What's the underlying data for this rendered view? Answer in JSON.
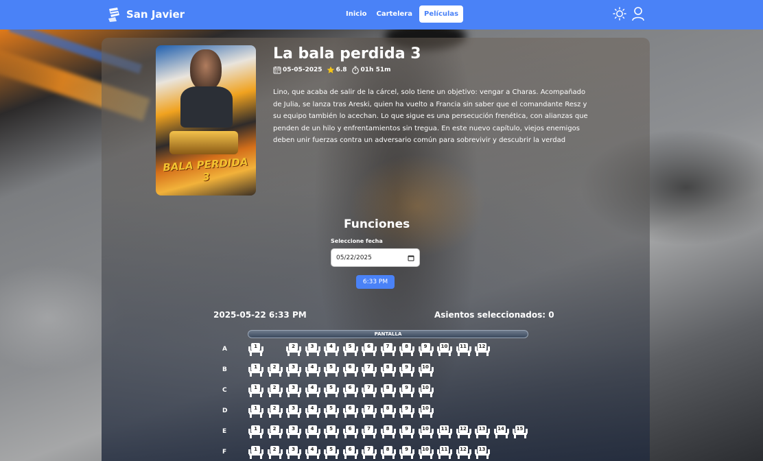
{
  "navbar": {
    "brand": "San Javier",
    "links": [
      "Inicio",
      "Cartelera",
      "Películas"
    ],
    "active_link": "Películas",
    "icons": [
      "sun-icon",
      "user-icon"
    ],
    "color": "#4a82f7"
  },
  "movie": {
    "title": "La bala perdida 3",
    "release_date": "05-05-2025",
    "rating": "6.8",
    "duration": "01h 51m",
    "poster_title": "BALA PERDIDA 3",
    "synopsis": "Lino, que acaba de salir de la cárcel, solo tiene un objetivo: vengar a Charas. Acompañado de Julia, se lanza tras Areski, quien ha vuelto a Francia sin saber que el comandante Resz y su equipo también lo acechan. Lo que sigue es una persecución frenética, con alianzas que penden de un hilo y enfrentamientos sin tregua. En este nuevo capítulo, viejos enemigos deben unir fuerzas contra un adversario común para sobrevivir y descubrir la verdad"
  },
  "funciones": {
    "title": "Funciones",
    "date_label": "Seleccione fecha",
    "date_value": "05/22/2025",
    "times": [
      "6:33 PM"
    ]
  },
  "seating": {
    "selected_datetime": "2025-05-22 6:33 PM",
    "selected_count_label": "Asientos seleccionados: 0",
    "screen_label": "PANTALLA",
    "rows": [
      {
        "label": "A",
        "seats": [
          1,
          null,
          2,
          3,
          4,
          5,
          6,
          7,
          8,
          9,
          10,
          11,
          12
        ]
      },
      {
        "label": "B",
        "seats": [
          1,
          2,
          3,
          4,
          5,
          6,
          7,
          8,
          9,
          10
        ]
      },
      {
        "label": "C",
        "seats": [
          1,
          2,
          3,
          4,
          5,
          6,
          7,
          8,
          9,
          10
        ]
      },
      {
        "label": "D",
        "seats": [
          1,
          2,
          3,
          4,
          5,
          6,
          7,
          8,
          9,
          10
        ]
      },
      {
        "label": "E",
        "seats": [
          1,
          2,
          3,
          4,
          5,
          6,
          7,
          8,
          9,
          10,
          11,
          12,
          13,
          14,
          15
        ]
      },
      {
        "label": "F",
        "seats": [
          1,
          2,
          3,
          4,
          5,
          6,
          7,
          8,
          9,
          10,
          11,
          12,
          13
        ]
      }
    ]
  }
}
